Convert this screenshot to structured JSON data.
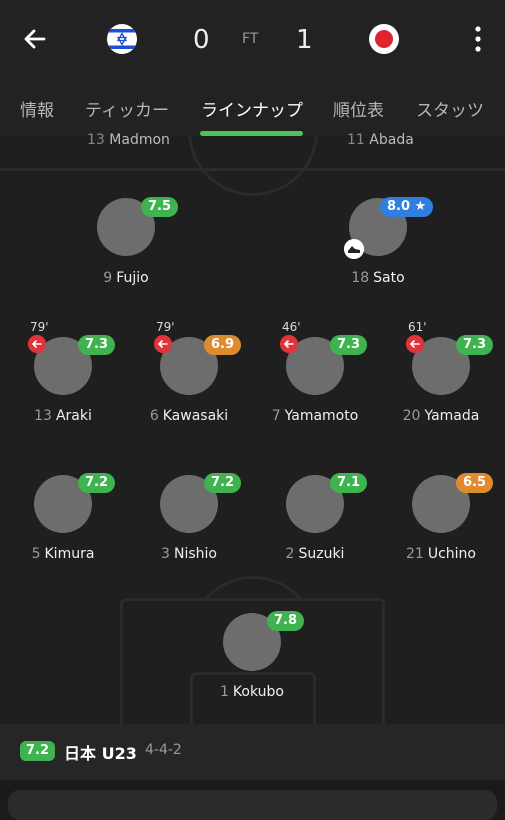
{
  "header": {
    "home_score": "0",
    "status": "FT",
    "away_score": "1",
    "home_flag": "israel-flag",
    "away_flag": "japan-flag"
  },
  "tabs": [
    "情報",
    "ティッカー",
    "ラインナップ",
    "順位表",
    "スタッツ"
  ],
  "active_tab": 2,
  "opponents_partial": [
    {
      "number": "13",
      "name": "Madmon"
    },
    {
      "number": "11",
      "name": "Abada"
    }
  ],
  "players": {
    "fujio": {
      "number": "9",
      "name": "Fujio",
      "rating": "7.5"
    },
    "sato": {
      "number": "18",
      "name": "Sato",
      "rating": "8.0 ★"
    },
    "araki": {
      "number": "13",
      "name": "Araki",
      "rating": "7.3",
      "sub": "79'"
    },
    "kawasaki": {
      "number": "6",
      "name": "Kawasaki",
      "rating": "6.9",
      "sub": "79'"
    },
    "yamamoto": {
      "number": "7",
      "name": "Yamamoto",
      "rating": "7.3",
      "sub": "46'"
    },
    "yamada": {
      "number": "20",
      "name": "Yamada",
      "rating": "7.3",
      "sub": "61'"
    },
    "kimura": {
      "number": "5",
      "name": "Kimura",
      "rating": "7.2"
    },
    "nishio": {
      "number": "3",
      "name": "Nishio",
      "rating": "7.2"
    },
    "suzuki": {
      "number": "2",
      "name": "Suzuki",
      "rating": "7.1"
    },
    "uchino": {
      "number": "21",
      "name": "Uchino",
      "rating": "6.5"
    },
    "kokubo": {
      "number": "1",
      "name": "Kokubo",
      "rating": "7.8"
    }
  },
  "footer": {
    "team_rating": "7.2",
    "team_name": "日本 U23",
    "formation": "4-4-2"
  },
  "colors": {
    "rating_green": "#3fb34f",
    "rating_orange": "#e08a2e",
    "rating_blue": "#2f7fe0",
    "tab_active_indicator": "#4ec25a",
    "sub_icon": "#e0333a"
  }
}
